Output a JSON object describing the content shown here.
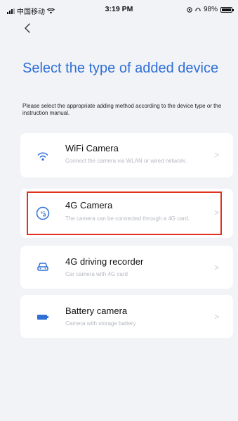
{
  "status_bar": {
    "carrier": "中国移动",
    "time": "3:19 PM",
    "battery": "98%",
    "battery_level": 0.98
  },
  "header": {
    "title": "Select the type of added device",
    "description": "Please select the appropriate adding method according to the device type or the instruction manual."
  },
  "devices": [
    {
      "name": "WiFi Camera",
      "subtitle": "Connect the camera via WLAN or wired network.",
      "icon": "wifi-icon"
    },
    {
      "name": "4G Camera",
      "subtitle": "The camera can be connected through a 4G card.",
      "icon": "4g-signal-icon"
    },
    {
      "name": "4G driving recorder",
      "subtitle": "Car camera with 4G card",
      "icon": "car-icon"
    },
    {
      "name": "Battery camera",
      "subtitle": "Camera with storage battery",
      "icon": "battery-icon"
    }
  ],
  "colors": {
    "accent": "#2f6fd6",
    "highlight": "#e0321f",
    "background": "#f2f3f7"
  }
}
